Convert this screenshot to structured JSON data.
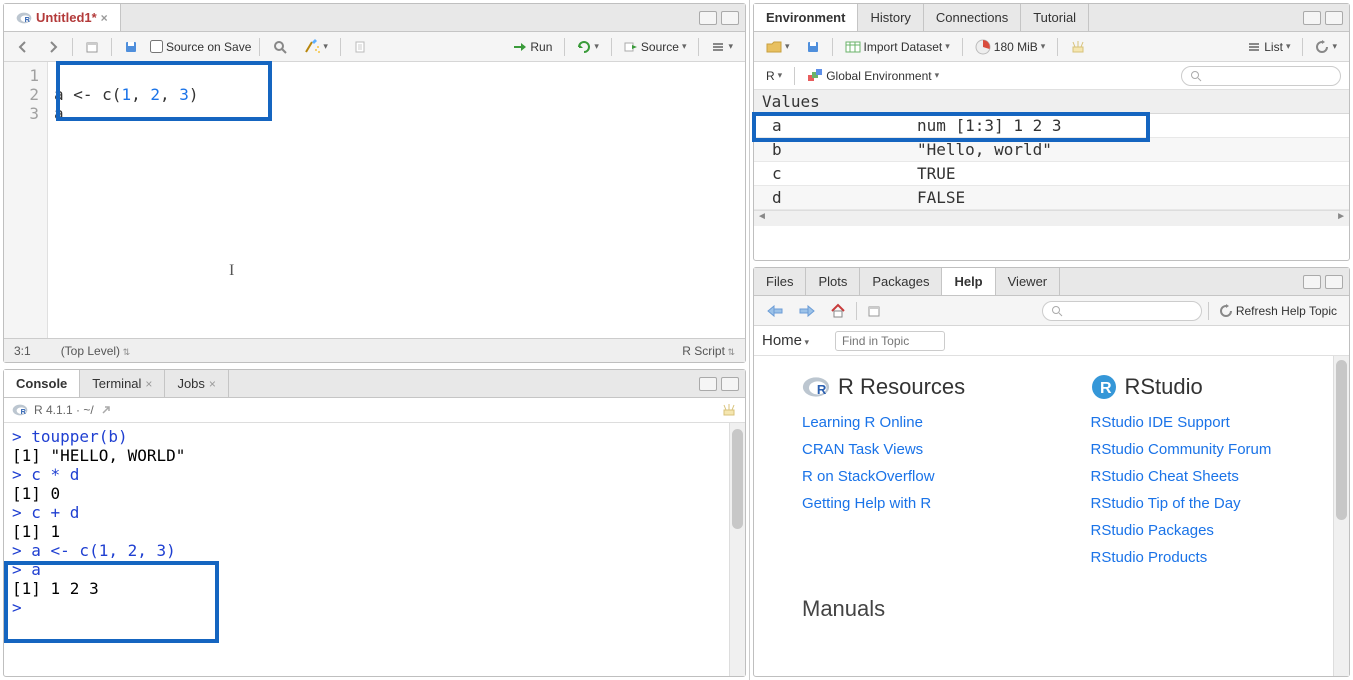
{
  "source": {
    "tab_label": "Untitled1*",
    "source_on_save": "Source on Save",
    "run": "Run",
    "source_btn": "Source",
    "lines": [
      "1",
      "2",
      "3"
    ],
    "code_line1_a": "a <- c(",
    "code_line1_n1": "1",
    "code_line1_c1": ", ",
    "code_line1_n2": "2",
    "code_line1_c2": ", ",
    "code_line1_n3": "3",
    "code_line1_end": ")",
    "code_line2": "a",
    "status_pos": "3:1",
    "status_scope": "(Top Level)",
    "status_type": "R Script"
  },
  "console": {
    "tabs": [
      "Console",
      "Terminal",
      "Jobs"
    ],
    "version": "R 4.1.1 · ~/",
    "l1": "> toupper(b)",
    "l2": "[1] \"HELLO, WORLD\"",
    "l3": "> c * d",
    "l4": "[1] 0",
    "l5": "> c + d",
    "l6": "[1] 1",
    "l7": "> a <- c(1, 2, 3)",
    "l8": "> a",
    "l9": "[1] 1 2 3",
    "l10": "> "
  },
  "env": {
    "tabs": [
      "Environment",
      "History",
      "Connections",
      "Tutorial"
    ],
    "import": "Import Dataset",
    "memory": "180 MiB",
    "list": "List",
    "scope_r": "R",
    "scope_env": "Global Environment",
    "section": "Values",
    "rows": [
      {
        "name": "a",
        "val": "num [1:3] 1 2 3"
      },
      {
        "name": "b",
        "val": "\"Hello, world\""
      },
      {
        "name": "c",
        "val": "TRUE"
      },
      {
        "name": "d",
        "val": "FALSE"
      }
    ]
  },
  "help": {
    "tabs": [
      "Files",
      "Plots",
      "Packages",
      "Help",
      "Viewer"
    ],
    "refresh": "Refresh Help Topic",
    "home": "Home",
    "find_placeholder": "Find in Topic",
    "r_head": "R Resources",
    "rs_head": "RStudio",
    "r_links": [
      "Learning R Online",
      "CRAN Task Views",
      "R on StackOverflow",
      "Getting Help with R"
    ],
    "rs_links": [
      "RStudio IDE Support",
      "RStudio Community Forum",
      "RStudio Cheat Sheets",
      "RStudio Tip of the Day",
      "RStudio Packages",
      "RStudio Products"
    ],
    "manuals": "Manuals"
  }
}
